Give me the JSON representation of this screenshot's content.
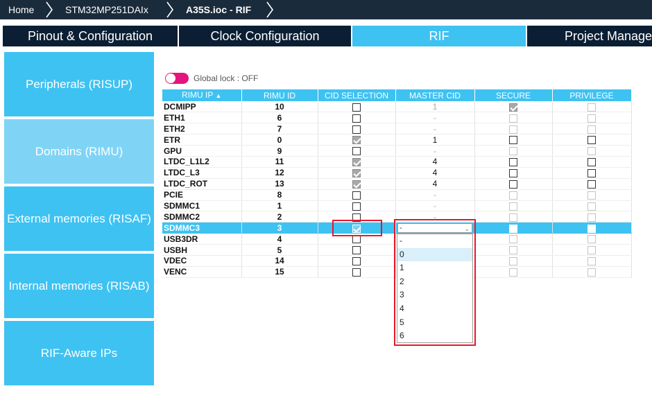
{
  "breadcrumb": {
    "home": "Home",
    "device": "STM32MP251DAIx",
    "file": "A35S.ioc - RIF"
  },
  "tabs": [
    {
      "label": "Pinout & Configuration",
      "active": false
    },
    {
      "label": "Clock Configuration",
      "active": false
    },
    {
      "label": "RIF",
      "active": true
    },
    {
      "label": "Project Manager",
      "active": false
    }
  ],
  "sidebar": {
    "items": [
      {
        "label": "Peripherals (RISUP)",
        "active": false
      },
      {
        "label": "Domains (RIMU)",
        "active": true
      },
      {
        "label": "External memories (RISAF)",
        "active": false
      },
      {
        "label": "Internal memories (RISAB)",
        "active": false
      },
      {
        "label": "RIF-Aware IPs",
        "active": false
      }
    ]
  },
  "global_lock": {
    "label": "Global lock : OFF",
    "on": true,
    "color": "#e6157d"
  },
  "table": {
    "columns": [
      "RIMU IP",
      "RIMU ID",
      "CID SELECTION",
      "MASTER CID",
      "SECURE",
      "PRIVILEGE"
    ],
    "sort_icon": "sort-arrow-icon",
    "rows": [
      {
        "ip": "DCMIPP",
        "id": "10",
        "cid": "unchecked",
        "master": "1",
        "master_dim": true,
        "secure": "checked",
        "privilege": "disabled"
      },
      {
        "ip": "ETH1",
        "id": "6",
        "cid": "unchecked",
        "master": "-",
        "master_dim": true,
        "secure": "disabled",
        "privilege": "disabled"
      },
      {
        "ip": "ETH2",
        "id": "7",
        "cid": "unchecked",
        "master": "-",
        "master_dim": true,
        "secure": "disabled",
        "privilege": "disabled"
      },
      {
        "ip": "ETR",
        "id": "0",
        "cid": "checked",
        "master": "1",
        "master_dim": false,
        "secure": "unchecked",
        "privilege": "unchecked"
      },
      {
        "ip": "GPU",
        "id": "9",
        "cid": "unchecked",
        "master": "-",
        "master_dim": true,
        "secure": "disabled",
        "privilege": "disabled"
      },
      {
        "ip": "LTDC_L1L2",
        "id": "11",
        "cid": "checked",
        "master": "4",
        "master_dim": false,
        "secure": "unchecked",
        "privilege": "unchecked"
      },
      {
        "ip": "LTDC_L3",
        "id": "12",
        "cid": "checked",
        "master": "4",
        "master_dim": false,
        "secure": "unchecked",
        "privilege": "unchecked"
      },
      {
        "ip": "LTDC_ROT",
        "id": "13",
        "cid": "checked",
        "master": "4",
        "master_dim": false,
        "secure": "unchecked",
        "privilege": "unchecked"
      },
      {
        "ip": "PCIE",
        "id": "8",
        "cid": "unchecked",
        "master": "-",
        "master_dim": true,
        "secure": "disabled",
        "privilege": "disabled"
      },
      {
        "ip": "SDMMC1",
        "id": "1",
        "cid": "unchecked",
        "master": "-",
        "master_dim": true,
        "secure": "disabled",
        "privilege": "disabled"
      },
      {
        "ip": "SDMMC2",
        "id": "2",
        "cid": "unchecked",
        "master": "-",
        "master_dim": true,
        "secure": "disabled",
        "privilege": "disabled"
      },
      {
        "ip": "SDMMC3",
        "id": "3",
        "cid": "checked",
        "master": "-",
        "master_dim": false,
        "secure": "unchecked",
        "privilege": "unchecked",
        "selected": true,
        "dropdown": true
      },
      {
        "ip": "USB3DR",
        "id": "4",
        "cid": "unchecked",
        "master": "-",
        "master_dim": true,
        "secure": "disabled",
        "privilege": "disabled"
      },
      {
        "ip": "USBH",
        "id": "5",
        "cid": "unchecked",
        "master": "-",
        "master_dim": true,
        "secure": "disabled",
        "privilege": "disabled"
      },
      {
        "ip": "VDEC",
        "id": "14",
        "cid": "unchecked",
        "master": "-",
        "master_dim": true,
        "secure": "disabled",
        "privilege": "disabled"
      },
      {
        "ip": "VENC",
        "id": "15",
        "cid": "unchecked",
        "master": "-",
        "master_dim": true,
        "secure": "disabled",
        "privilege": "disabled"
      }
    ]
  },
  "master_cid_select": {
    "value": "-",
    "options": [
      "-",
      "0",
      "1",
      "2",
      "3",
      "4",
      "5",
      "6"
    ],
    "hovered": "0"
  },
  "colors": {
    "accent": "#3ec2f2",
    "header_dark": "#1a2b3c",
    "tab_dark": "#0b1e33",
    "sidebar_active": "#7fd4f6",
    "highlight": "#e8172b"
  }
}
